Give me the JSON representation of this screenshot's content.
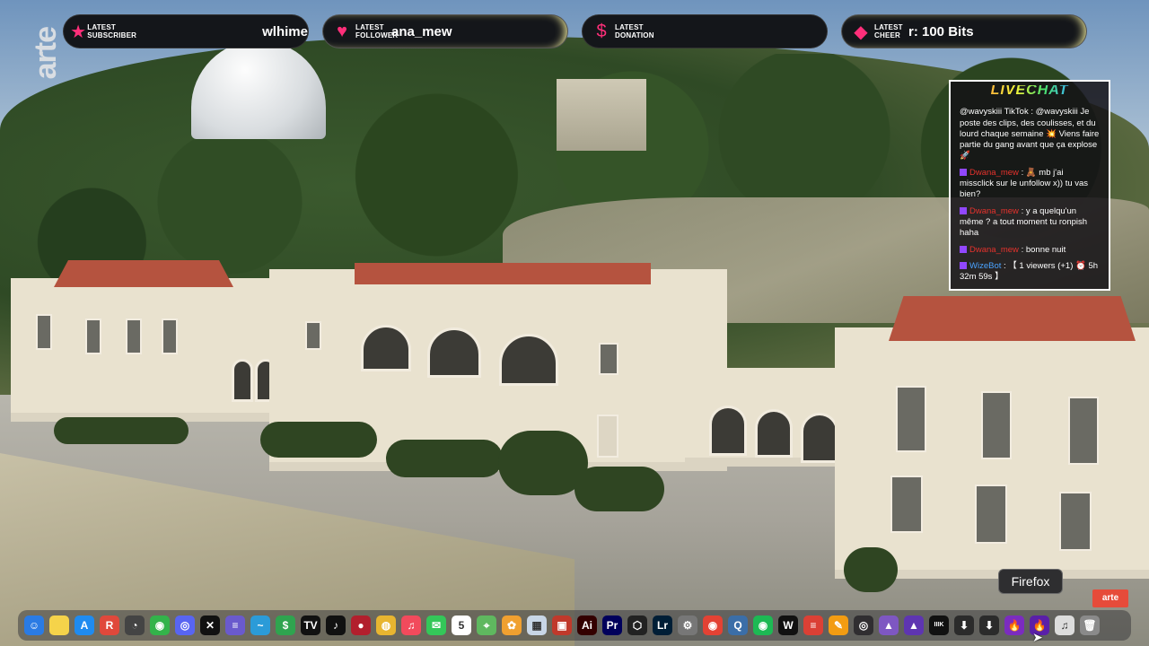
{
  "alerts": [
    {
      "label": "LATEST SUBSCRIBER",
      "value": "wlhime",
      "icon": "star-icon"
    },
    {
      "label": "LATEST FOLLOWER",
      "value": "ana_mew",
      "icon": "heart-icon"
    },
    {
      "label": "LATEST DONATION",
      "value": "",
      "icon": "dollar-icon"
    },
    {
      "label": "LATEST CHEER",
      "value": "r: 100 Bits",
      "icon": "diamond-icon"
    }
  ],
  "channel_logo": "arte",
  "livechat": {
    "title": "LIVECHAT",
    "messages": [
      {
        "user": "@wavyskiii",
        "text": "TikTok : @wavyskiii Je poste des clips, des coulisses, et du lourd chaque semaine 💥 Viens faire partie du gang avant que ça explose 🚀"
      },
      {
        "user": "Dwana_mew",
        "text": ": 🧸 mb j'ai missclick sur le unfollow x)) tu vas bien?"
      },
      {
        "user": "Dwana_mew",
        "text": ": y a quelqu'un même ? a tout moment tu ronpish haha"
      },
      {
        "user": "Dwana_mew",
        "text": ": bonne nuit"
      },
      {
        "user": "WizeBot",
        "text": ": 【 1 viewers (+1) ⏰ 5h 32m 59s 】"
      }
    ]
  },
  "tooltip": "Firefox",
  "watermark": "arte",
  "dock": {
    "apps": [
      {
        "name": "finder",
        "glyph": "☺",
        "color": "#2a7be4"
      },
      {
        "name": "notes",
        "glyph": "",
        "color": "#f5d34a"
      },
      {
        "name": "app-store",
        "glyph": "A",
        "color": "#1f8bf0"
      },
      {
        "name": "reeder",
        "glyph": "R",
        "color": "#e0483b"
      },
      {
        "name": "system-monitor",
        "glyph": "◔",
        "color": "#444"
      },
      {
        "name": "messenger",
        "glyph": "◉",
        "color": "#33b34a"
      },
      {
        "name": "discord",
        "glyph": "◎",
        "color": "#5865f2"
      },
      {
        "name": "capcut",
        "glyph": "✕",
        "color": "#111"
      },
      {
        "name": "notion",
        "glyph": "≡",
        "color": "#6a5acd"
      },
      {
        "name": "freeform",
        "glyph": "~",
        "color": "#2b9bd8"
      },
      {
        "name": "robinhood",
        "glyph": "$",
        "color": "#2fa44f"
      },
      {
        "name": "tradingview",
        "glyph": "TV",
        "color": "#111"
      },
      {
        "name": "tiktok",
        "glyph": "♪",
        "color": "#111"
      },
      {
        "name": "opus",
        "glyph": "●",
        "color": "#b21f2d"
      },
      {
        "name": "chrome",
        "glyph": "◍",
        "color": "#e8b530"
      },
      {
        "name": "music",
        "glyph": "♫",
        "color": "#f24a5c"
      },
      {
        "name": "messages",
        "glyph": "✉",
        "color": "#34c759"
      },
      {
        "name": "calendar",
        "glyph": "5",
        "color": "#ffffff"
      },
      {
        "name": "maps",
        "glyph": "⌖",
        "color": "#5fb85f"
      },
      {
        "name": "photos",
        "glyph": "✿",
        "color": "#f0a030"
      },
      {
        "name": "preview",
        "glyph": "▦",
        "color": "#c8d6e6"
      },
      {
        "name": "ps-tool",
        "glyph": "▣",
        "color": "#c0392b"
      },
      {
        "name": "illustrator",
        "glyph": "Ai",
        "color": "#330000"
      },
      {
        "name": "premiere",
        "glyph": "Pr",
        "color": "#00005b"
      },
      {
        "name": "unity",
        "glyph": "⬡",
        "color": "#222"
      },
      {
        "name": "lightroom",
        "glyph": "Lr",
        "color": "#001e36"
      },
      {
        "name": "system-settings",
        "glyph": "⚙",
        "color": "#777"
      },
      {
        "name": "record",
        "glyph": "◉",
        "color": "#e34234"
      },
      {
        "name": "quicktime",
        "glyph": "Q",
        "color": "#3b6ea8"
      },
      {
        "name": "spotify",
        "glyph": "◉",
        "color": "#1db954"
      },
      {
        "name": "waves",
        "glyph": "W",
        "color": "#111"
      },
      {
        "name": "todoist",
        "glyph": "≡",
        "color": "#db4035"
      },
      {
        "name": "fl-studio",
        "glyph": "✎",
        "color": "#f39c12"
      },
      {
        "name": "obs",
        "glyph": "◎",
        "color": "#302e31"
      },
      {
        "name": "affinity-1",
        "glyph": "▲",
        "color": "#7e57c2"
      },
      {
        "name": "affinity-2",
        "glyph": "▲",
        "color": "#5e35b1"
      },
      {
        "name": "font-tool",
        "glyph": "IIIK",
        "color": "#111"
      },
      {
        "name": "download-1",
        "glyph": "⬇",
        "color": "#2b2b2b"
      },
      {
        "name": "download-2",
        "glyph": "⬇",
        "color": "#2b2b2b"
      },
      {
        "name": "firefox",
        "glyph": "🔥",
        "color": "#7b2cbf"
      },
      {
        "name": "firefox-dev",
        "glyph": "🔥",
        "color": "#5a1fa8"
      },
      {
        "name": "document",
        "glyph": "♫",
        "color": "#dcdcdc"
      },
      {
        "name": "trash",
        "glyph": "🗑",
        "color": "#8a8a8a"
      }
    ]
  }
}
